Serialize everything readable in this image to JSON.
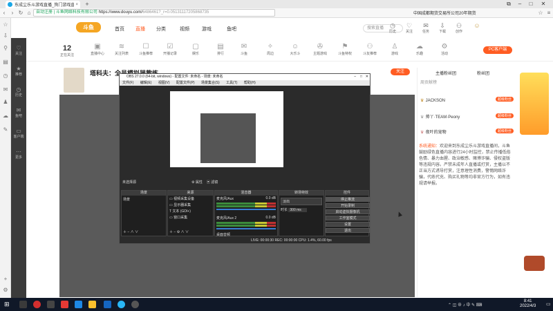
{
  "browser": {
    "tab_title": "东成尘乐斗游戏直播_狗门游戏直播_斗鱼",
    "url_secure": "自动注册 | 斗鱼网络科技有限公司",
    "url_domain": "https://www.douyu.com/",
    "url_path": "6486461?_r=0.05131117205868735",
    "ticker": "中国成都期货交易所公司20年期货"
  },
  "header": {
    "logo": "斗鱼",
    "nav": [
      "首页",
      "直播",
      "分类",
      "视频",
      "游戏",
      "鱼吧"
    ],
    "active_nav": "直播",
    "search_placeholder": "搜索直播",
    "icons": [
      {
        "name": "history-icon",
        "label": "历史",
        "glyph": "◷"
      },
      {
        "name": "follow-icon",
        "label": "关注",
        "glyph": "♡"
      },
      {
        "name": "task-icon",
        "label": "任务",
        "glyph": "✉"
      },
      {
        "name": "download-icon",
        "label": "下载",
        "glyph": "⇩"
      },
      {
        "name": "create-icon",
        "label": "创作",
        "glyph": "⚇"
      },
      {
        "name": "user-avatar",
        "label": "",
        "glyph": "☺"
      }
    ]
  },
  "category": {
    "follow_count": "12",
    "follow_label": "正在关注",
    "items": [
      "直播中心",
      "关注列表",
      "斗鱼推荐",
      "开播记录",
      "娱乐",
      "排行",
      "斗鱼",
      "周边",
      "大乐斗",
      "主题游戏",
      "斗鱼特权",
      "斗友推荐",
      "游戏",
      "乐趣",
      "活动"
    ],
    "pc_button": "PC客户端"
  },
  "sidebar_left": [
    "关注",
    "推荐",
    "历史",
    "鱼吧",
    "客户端",
    "更多"
  ],
  "stream": {
    "title": "塔科夫：全员模拟器教练",
    "follow_button": "关注"
  },
  "chat": {
    "tabs": [
      "主播粉丝团",
      "粉丝团"
    ],
    "rank_title": "周贡献榜",
    "rows": [
      {
        "name": "JACKSON",
        "badge": "超级粉丝"
      },
      {
        "name": "帅丫·TEAM·Peony",
        "badge": "超级粉丝"
      },
      {
        "name": "夜叶的宠物",
        "badge": "超级粉丝"
      }
    ],
    "notice_head": "系统通知：",
    "notice_body": "欢迎来到东成尘乐斗游戏直播间，斗鱼鼓励绿色直播内容进行24小时监控，禁止传播低俗色情、暴力血腥、政治敏感、赌博诈骗、侵权盗版等违规内容。严禁未成年人直播或打赏，主播以不正当方式诱导打赏，注意理性消费，警惕网络诈骗，代练代充、购买礼物等均非官方行为，如有违规请举报。"
  },
  "obs": {
    "title": "OBS 27.0.0 (64-bit, windows) - 配置文件: 未命名 - 场景: 未命名",
    "menu": [
      "文件(F)",
      "编辑(E)",
      "视图(V)",
      "配置文件(P)",
      "场景集合(S)",
      "工具(T)",
      "帮助(H)"
    ],
    "no_source": "未选择源",
    "props_btn": "属性",
    "filter_btn": "滤镜",
    "scenes_header": "场景",
    "scene_item": "场景",
    "sources_header": "来源",
    "sources": [
      "视频采集设备",
      "显示器采集",
      "文本 (GDI+)",
      "窗口采集"
    ],
    "mixer_header": "混音器",
    "mixer": [
      {
        "name": "麦克风/Aux",
        "db": "0.0 dB"
      },
      {
        "name": "麦克风/Aux 2",
        "db": "0.0 dB"
      }
    ],
    "desktop_audio": "桌面音频",
    "transitions_header": "转场特效",
    "transition": "淡出",
    "duration_label": "时长",
    "duration_value": "300 ms",
    "controls_header": "控件",
    "controls": [
      "停止推流",
      "开始录制",
      "启动虚拟摄像机",
      "工作室模式",
      "设置",
      "退出"
    ],
    "status": "LIVE: 00:00:30   REC: 00:00:00   CPU: 1.4%, 60.00 fps"
  },
  "taskbar": {
    "time": "8:41",
    "date": "2022/4/3"
  }
}
